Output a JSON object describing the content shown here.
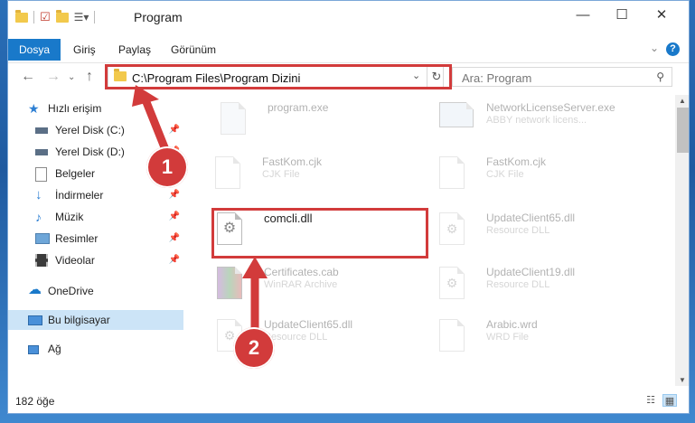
{
  "window": {
    "title": "Program",
    "minimize_icon": "minimize-icon",
    "maximize_icon": "maximize-icon",
    "close_icon": "close-icon"
  },
  "ribbon": {
    "tabs": [
      {
        "label": "Dosya",
        "active": true
      },
      {
        "label": "Giriş"
      },
      {
        "label": "Paylaş"
      },
      {
        "label": "Görünüm"
      }
    ],
    "help_label": "?"
  },
  "address": {
    "path": "C:\\Program Files\\Program Dizini",
    "search_placeholder": "Ara: Program"
  },
  "sidebar": {
    "quick_access": "Hızlı erişim",
    "items": [
      {
        "label": "Yerel Disk (C:)",
        "pinned": true
      },
      {
        "label": "Yerel Disk (D:)",
        "pinned": true
      },
      {
        "label": "Belgeler",
        "pinned": true
      },
      {
        "label": "İndirmeler",
        "pinned": true
      },
      {
        "label": "Müzik",
        "pinned": true
      },
      {
        "label": "Resimler",
        "pinned": true
      },
      {
        "label": "Videolar",
        "pinned": true
      }
    ],
    "onedrive": "OneDrive",
    "this_pc": "Bu bilgisayar",
    "network": "Ağ"
  },
  "files": [
    {
      "name": "program.exe",
      "type": ""
    },
    {
      "name": "NetworkLicenseServer.exe",
      "type": "ABBY network licens..."
    },
    {
      "name": "FastKom.cjk",
      "type": "CJK File"
    },
    {
      "name": "FastKom.cjk",
      "type": "CJK File"
    },
    {
      "name": "comcli.dll",
      "type": ""
    },
    {
      "name": "UpdateClient65.dll",
      "type": "Resource DLL"
    },
    {
      "name": "Certificates.cab",
      "type": "WinRAR Archive"
    },
    {
      "name": "UpdateClient19.dll",
      "type": "Resource DLL"
    },
    {
      "name": "UpdateClient65.dll",
      "type": "Resource DLL"
    },
    {
      "name": "Arabic.wrd",
      "type": "WRD File"
    }
  ],
  "status": {
    "item_count": "182 öğe"
  },
  "annotations": {
    "step1": "1",
    "step2": "2",
    "color": "#d23b3b"
  },
  "colors": {
    "accent": "#1979ca",
    "selection": "#cce4f7"
  }
}
